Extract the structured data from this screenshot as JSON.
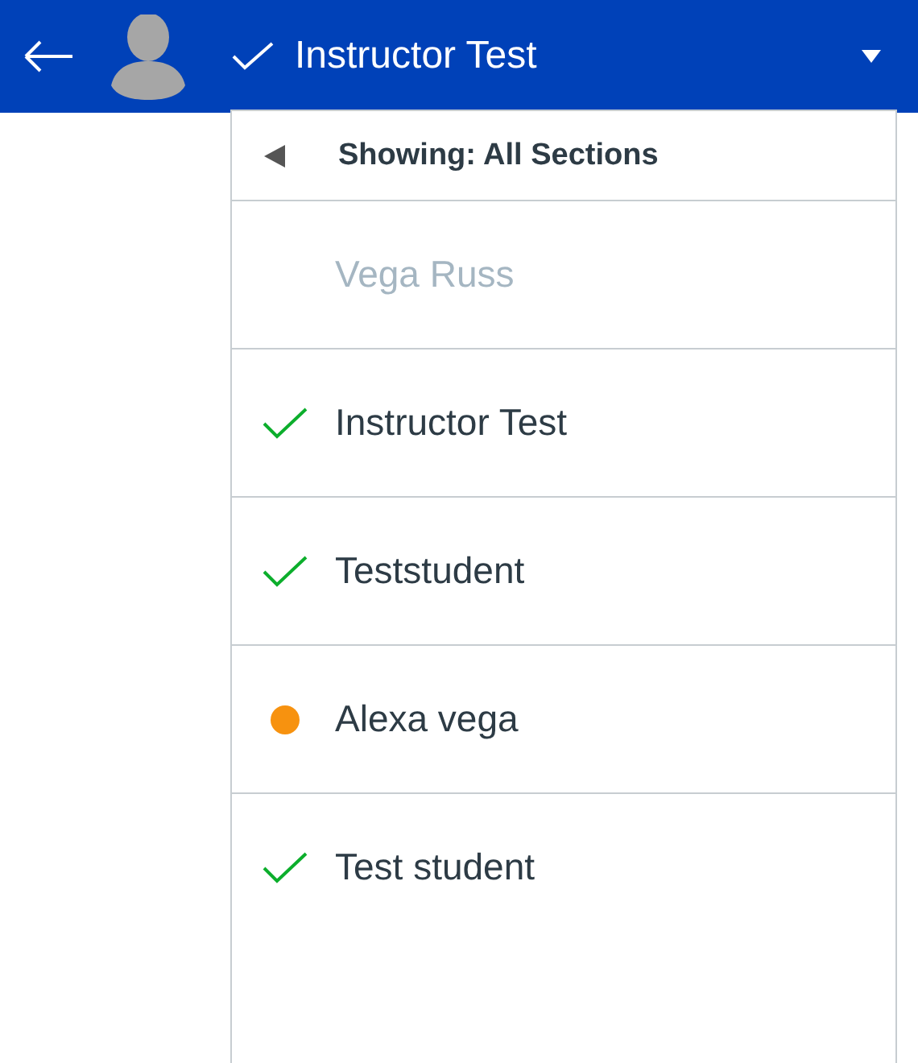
{
  "header": {
    "title": "Instructor Test",
    "title_checked": true
  },
  "dropdown": {
    "heading": "Showing: All Sections",
    "items": [
      {
        "name": "Vega Russ",
        "kind": "none",
        "disabled": true
      },
      {
        "name": "Instructor Test",
        "kind": "check",
        "disabled": false
      },
      {
        "name": "Teststudent",
        "kind": "check",
        "disabled": false
      },
      {
        "name": "Alexa vega",
        "kind": "dot",
        "disabled": false,
        "color": "#f7920f"
      },
      {
        "name": "Test student",
        "kind": "check",
        "disabled": false
      }
    ]
  }
}
